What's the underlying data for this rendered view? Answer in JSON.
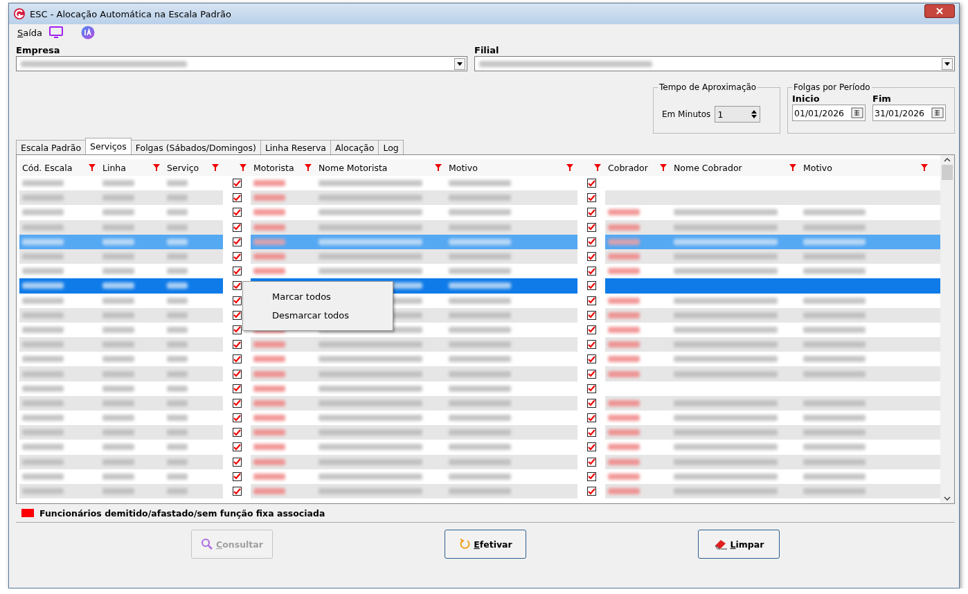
{
  "window": {
    "title": "ESC - Alocação Automática na Escala Padrão"
  },
  "menu": [
    {
      "label": "Saída"
    }
  ],
  "empresa": {
    "label": "Empresa"
  },
  "filial": {
    "label": "Filial"
  },
  "tempo": {
    "title": "Tempo de Aproximação",
    "label": "Em Minutos",
    "value": "1"
  },
  "folgas": {
    "title": "Folgas por Período",
    "inicio_label": "Inicio",
    "inicio": "01/01/2026",
    "fim_label": "Fim",
    "fim": "31/01/2026"
  },
  "tabs": [
    {
      "label": "Escala Padrão",
      "selected": false
    },
    {
      "label": "Serviços",
      "selected": true
    },
    {
      "label": "Folgas (Sábados/Domingos)",
      "selected": false
    },
    {
      "label": "Linha Reserva",
      "selected": false
    },
    {
      "label": "Alocação",
      "selected": false
    },
    {
      "label": "Log",
      "selected": false
    }
  ],
  "table": {
    "columns": [
      {
        "label": "Cód. Escala",
        "kind": "text"
      },
      {
        "label": "Linha",
        "kind": "text"
      },
      {
        "label": "Serviço",
        "kind": "text"
      },
      {
        "kind": "check"
      },
      {
        "label": "Motorista",
        "kind": "code"
      },
      {
        "label": "Nome Motorista",
        "kind": "text"
      },
      {
        "label": "Motivo",
        "kind": "text"
      },
      {
        "kind": "check"
      },
      {
        "label": "Cobrador",
        "kind": "code"
      },
      {
        "label": "Nome Cobrador",
        "kind": "text"
      },
      {
        "label": "Motivo",
        "kind": "text"
      }
    ],
    "rows": [
      {
        "selected": false,
        "focused": false,
        "motorista_checked": true,
        "cobrador_checked": true,
        "cobrador_filled": false
      },
      {
        "selected": false,
        "focused": false,
        "motorista_checked": true,
        "cobrador_checked": true,
        "cobrador_filled": false
      },
      {
        "selected": false,
        "focused": false,
        "motorista_checked": true,
        "cobrador_checked": true,
        "cobrador_filled": true
      },
      {
        "selected": false,
        "focused": false,
        "motorista_checked": true,
        "cobrador_checked": true,
        "cobrador_filled": true
      },
      {
        "selected": true,
        "focused": false,
        "motorista_checked": true,
        "cobrador_checked": true,
        "cobrador_filled": true
      },
      {
        "selected": false,
        "focused": false,
        "motorista_checked": true,
        "cobrador_checked": true,
        "cobrador_filled": true
      },
      {
        "selected": false,
        "focused": false,
        "motorista_checked": true,
        "cobrador_checked": true,
        "cobrador_filled": true
      },
      {
        "selected": true,
        "focused": true,
        "motorista_checked": true,
        "cobrador_checked": true,
        "cobrador_filled": false
      },
      {
        "selected": false,
        "focused": false,
        "motorista_checked": true,
        "cobrador_checked": true,
        "cobrador_filled": true
      },
      {
        "selected": false,
        "focused": false,
        "motorista_checked": true,
        "cobrador_checked": true,
        "cobrador_filled": true
      },
      {
        "selected": false,
        "focused": false,
        "motorista_checked": true,
        "cobrador_checked": true,
        "cobrador_filled": true
      },
      {
        "selected": false,
        "focused": false,
        "motorista_checked": true,
        "cobrador_checked": true,
        "cobrador_filled": true
      },
      {
        "selected": false,
        "focused": false,
        "motorista_checked": true,
        "cobrador_checked": true,
        "cobrador_filled": true
      },
      {
        "selected": false,
        "focused": false,
        "motorista_checked": true,
        "cobrador_checked": true,
        "cobrador_filled": true
      },
      {
        "selected": false,
        "focused": false,
        "motorista_checked": true,
        "cobrador_checked": true,
        "cobrador_filled": false
      },
      {
        "selected": false,
        "focused": false,
        "motorista_checked": true,
        "cobrador_checked": true,
        "cobrador_filled": true
      },
      {
        "selected": false,
        "focused": false,
        "motorista_checked": true,
        "cobrador_checked": true,
        "cobrador_filled": true
      },
      {
        "selected": false,
        "focused": false,
        "motorista_checked": true,
        "cobrador_checked": true,
        "cobrador_filled": true
      },
      {
        "selected": false,
        "focused": false,
        "motorista_checked": true,
        "cobrador_checked": true,
        "cobrador_filled": true
      },
      {
        "selected": false,
        "focused": false,
        "motorista_checked": true,
        "cobrador_checked": true,
        "cobrador_filled": true
      },
      {
        "selected": false,
        "focused": false,
        "motorista_checked": true,
        "cobrador_checked": true,
        "cobrador_filled": true
      },
      {
        "selected": false,
        "focused": false,
        "motorista_checked": true,
        "cobrador_checked": true,
        "cobrador_filled": true
      }
    ]
  },
  "context_menu": [
    {
      "label": "Marcar todos"
    },
    {
      "label": "Desmarcar todos"
    }
  ],
  "legend": {
    "label": "Funcionários demitido/afastado/sem função fixa associada",
    "color": "#ff0000"
  },
  "buttons": [
    {
      "label": "Consultar",
      "kind": "search",
      "disabled": true
    },
    {
      "label": "Efetivar",
      "kind": "refresh",
      "disabled": false
    },
    {
      "label": "Limpar",
      "kind": "eraser",
      "disabled": false
    }
  ]
}
